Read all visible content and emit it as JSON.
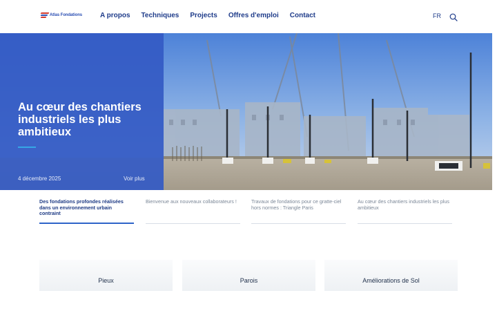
{
  "header": {
    "logo_text": "Atlas Fondations",
    "nav": [
      {
        "label": "A propos"
      },
      {
        "label": "Techniques"
      },
      {
        "label": "Projects"
      },
      {
        "label": "Offres d'emploi"
      },
      {
        "label": "Contact"
      }
    ],
    "language": "FR",
    "search_icon": "search-icon"
  },
  "hero": {
    "title": "Au cœur des chantiers industriels les plus ambitieux",
    "date": "4 décembre 2025",
    "more_label": "Voir plus",
    "image": "construction-site-with-piling-rigs"
  },
  "tabs": [
    {
      "label": "Des fondations profondes réalisées dans un environnement urbain contraint",
      "active": true
    },
    {
      "label": "Bienvenue aux nouveaux collaborateurs !",
      "active": false
    },
    {
      "label": "Travaux de fondations pour ce gratte-ciel hors normes : Triangle Paris",
      "active": false
    },
    {
      "label": "Au cœur des chantiers industriels les plus ambitieux",
      "active": false
    }
  ],
  "categories": [
    {
      "label": "Pieux"
    },
    {
      "label": "Parois"
    },
    {
      "label": "Améliorations de Sol"
    }
  ],
  "colors": {
    "brand_blue": "#345ac4",
    "nav_text": "#1f3c8a",
    "accent_rule": "#36a7e6",
    "logo_red": "#d33a2c"
  }
}
